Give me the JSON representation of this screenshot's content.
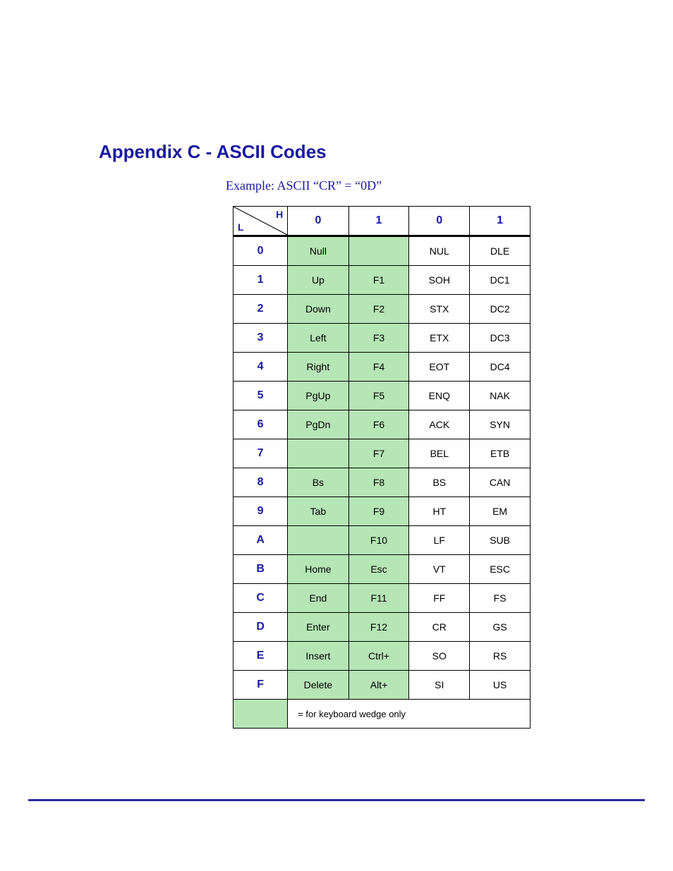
{
  "title": "Appendix C - ASCII Codes",
  "example": "Example: ASCII “CR” = “0D”",
  "corner": {
    "h": "H",
    "l": "L"
  },
  "col_headers": [
    "0",
    "1",
    "0",
    "1"
  ],
  "rows": [
    {
      "hdr": "0",
      "cells": [
        "Null",
        "",
        "NUL",
        "DLE"
      ]
    },
    {
      "hdr": "1",
      "cells": [
        "Up",
        "F1",
        "SOH",
        "DC1"
      ]
    },
    {
      "hdr": "2",
      "cells": [
        "Down",
        "F2",
        "STX",
        "DC2"
      ]
    },
    {
      "hdr": "3",
      "cells": [
        "Left",
        "F3",
        "ETX",
        "DC3"
      ]
    },
    {
      "hdr": "4",
      "cells": [
        "Right",
        "F4",
        "EOT",
        "DC4"
      ]
    },
    {
      "hdr": "5",
      "cells": [
        "PgUp",
        "F5",
        "ENQ",
        "NAK"
      ]
    },
    {
      "hdr": "6",
      "cells": [
        "PgDn",
        "F6",
        "ACK",
        "SYN"
      ]
    },
    {
      "hdr": "7",
      "cells": [
        "",
        "F7",
        "BEL",
        "ETB"
      ]
    },
    {
      "hdr": "8",
      "cells": [
        "Bs",
        "F8",
        "BS",
        "CAN"
      ]
    },
    {
      "hdr": "9",
      "cells": [
        "Tab",
        "F9",
        "HT",
        "EM"
      ]
    },
    {
      "hdr": "A",
      "cells": [
        "",
        "F10",
        "LF",
        "SUB"
      ]
    },
    {
      "hdr": "B",
      "cells": [
        "Home",
        "Esc",
        "VT",
        "ESC"
      ]
    },
    {
      "hdr": "C",
      "cells": [
        "End",
        "F11",
        "FF",
        "FS"
      ]
    },
    {
      "hdr": "D",
      "cells": [
        "Enter",
        "F12",
        "CR",
        "GS"
      ]
    },
    {
      "hdr": "E",
      "cells": [
        "Insert",
        "Ctrl+",
        "SO",
        "RS"
      ]
    },
    {
      "hdr": "F",
      "cells": [
        "Delete",
        "Alt+",
        "SI",
        "US"
      ]
    }
  ],
  "green_columns": [
    0,
    1
  ],
  "footnote": "= for keyboard wedge only"
}
